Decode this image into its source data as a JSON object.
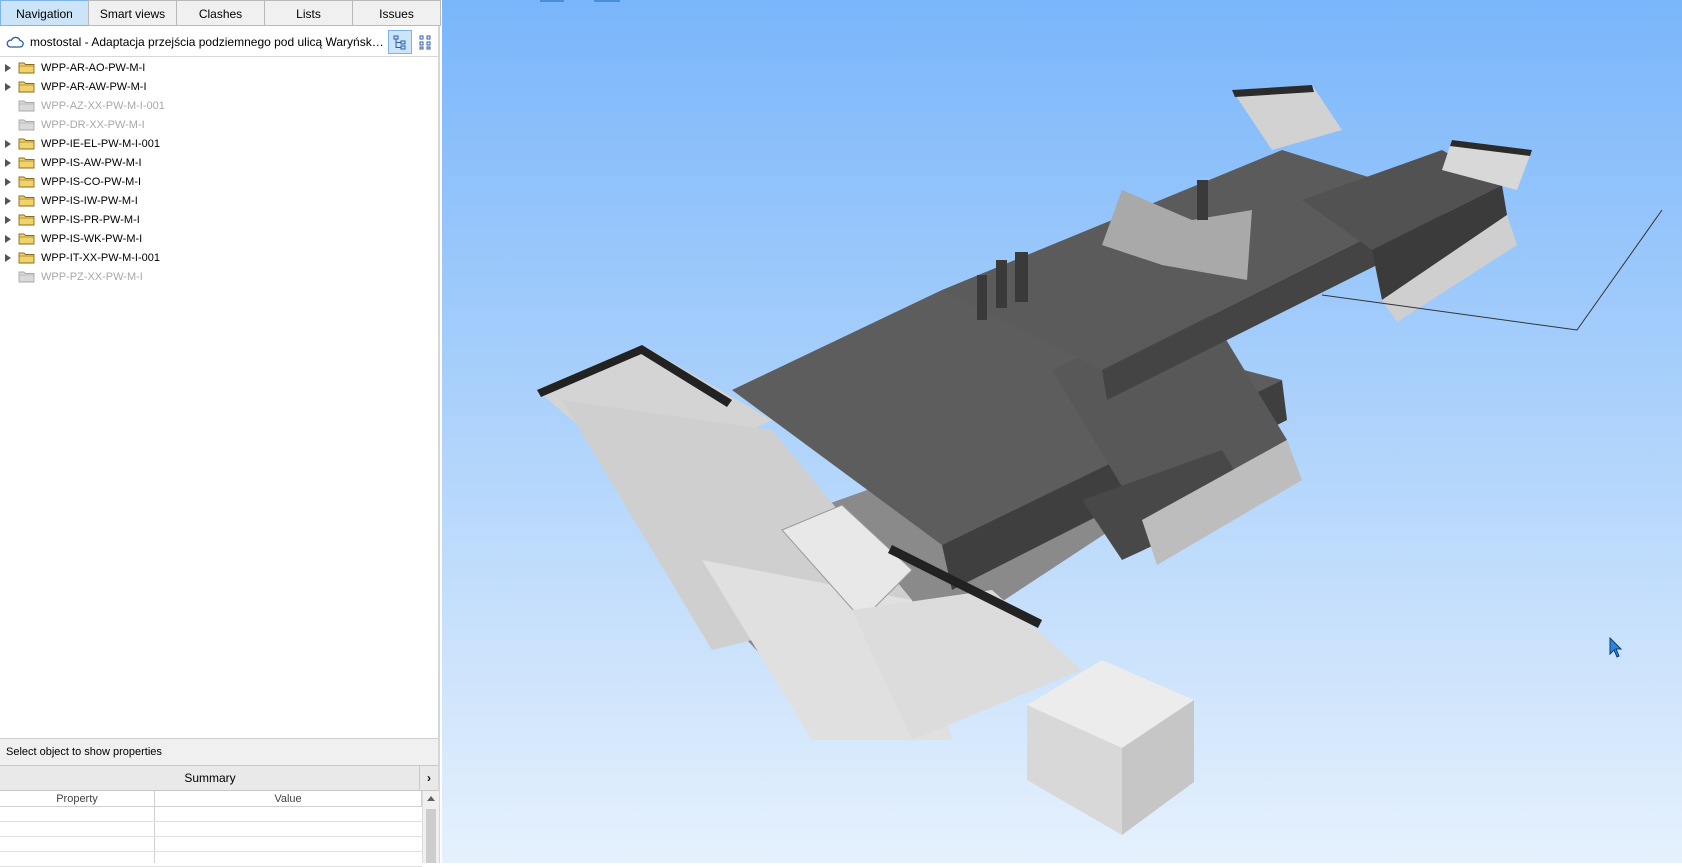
{
  "tabs": [
    {
      "label": "Navigation",
      "active": true
    },
    {
      "label": "Smart views",
      "active": false
    },
    {
      "label": "Clashes",
      "active": false
    },
    {
      "label": "Lists",
      "active": false
    },
    {
      "label": "Issues",
      "active": false
    }
  ],
  "project": {
    "icon": "cloud-icon",
    "title": "mostostal - Adaptacja przejścia podziemnego pod ulicą Waryńskiego..."
  },
  "tree": {
    "items": [
      {
        "label": "WPP-AR-AO-PW-M-I",
        "enabled": true,
        "expandable": true
      },
      {
        "label": "WPP-AR-AW-PW-M-I",
        "enabled": true,
        "expandable": true
      },
      {
        "label": "WPP-AZ-XX-PW-M-I-001",
        "enabled": false,
        "expandable": false
      },
      {
        "label": "WPP-DR-XX-PW-M-I",
        "enabled": false,
        "expandable": false
      },
      {
        "label": "WPP-IE-EL-PW-M-I-001",
        "enabled": true,
        "expandable": true
      },
      {
        "label": "WPP-IS-AW-PW-M-I",
        "enabled": true,
        "expandable": true
      },
      {
        "label": "WPP-IS-CO-PW-M-I",
        "enabled": true,
        "expandable": true
      },
      {
        "label": "WPP-IS-IW-PW-M-I",
        "enabled": true,
        "expandable": true
      },
      {
        "label": "WPP-IS-PR-PW-M-I",
        "enabled": true,
        "expandable": true
      },
      {
        "label": "WPP-IS-WK-PW-M-I",
        "enabled": true,
        "expandable": true
      },
      {
        "label": "WPP-IT-XX-PW-M-I-001",
        "enabled": true,
        "expandable": true
      },
      {
        "label": "WPP-PZ-XX-PW-M-I",
        "enabled": false,
        "expandable": false
      }
    ]
  },
  "properties": {
    "header": "Select object to show properties",
    "summary_label": "Summary",
    "columns": [
      "Property",
      "Value"
    ]
  },
  "colors": {
    "folder": "#f2d36b",
    "folder_disabled": "#d9d9d9",
    "tab_active": "#cce4f7",
    "sky_top": "#7ab6fb",
    "sky_bottom": "#e6f1fd",
    "slab": "#5f5f5f",
    "wall": "#c8c8c8"
  }
}
